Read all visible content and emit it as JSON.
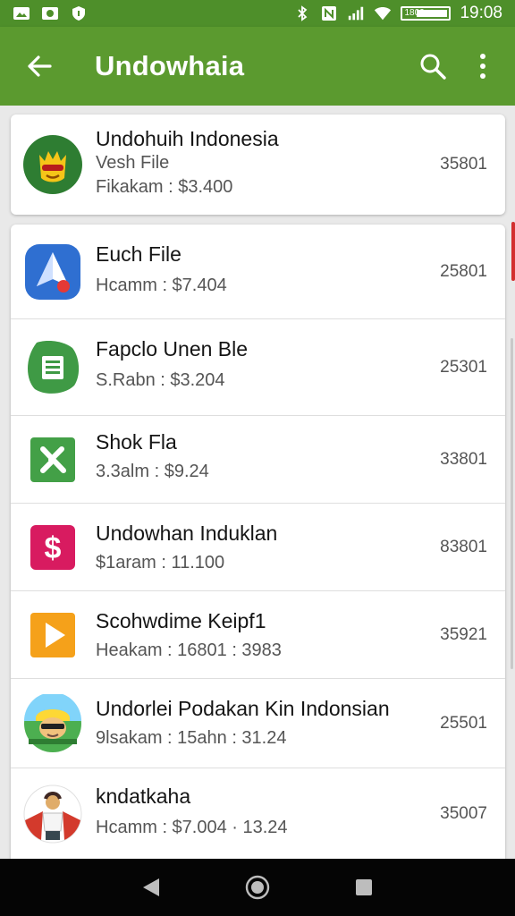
{
  "status_bar": {
    "time": "19:08",
    "battery_label": "1800",
    "signal_text": "1"
  },
  "app_bar": {
    "title": "Undowhaia",
    "back_icon": "arrow-left-icon",
    "search_icon": "search-icon",
    "menu_icon": "more-vert-icon"
  },
  "featured": {
    "title": "Undohuih Indonesia",
    "subtitle": "Vesh File",
    "meta": "Fikakam : $3.400",
    "count": "35801"
  },
  "items": [
    {
      "title": "Euch File",
      "meta": "Hcamm : $7.404",
      "count": "25801",
      "icon": "location-arrow-icon",
      "icon_color": "#2f6fd1"
    },
    {
      "title": "Fapclo Unen Ble",
      "meta": "S.Rabn : $3.204",
      "count": "25301",
      "icon": "sheets-icon",
      "icon_color": "#3f9a45"
    },
    {
      "title": "Shok Fla",
      "meta": "3.3alm : $9.24",
      "count": "33801",
      "icon": "excel-icon",
      "icon_color": "#43a047"
    },
    {
      "title": "Undowhan Induklan",
      "meta": "$1aram : 11.100",
      "count": "83801",
      "icon": "dollar-icon",
      "icon_color": "#d81b60"
    },
    {
      "title": "Scohwdime Keipf1",
      "meta": "Heakam : 16801 : 3983",
      "count": "35921",
      "icon": "play-icon",
      "icon_color": "#f5a11a"
    },
    {
      "title": "Undorlei Podakan Kin Indonsian",
      "meta": "9lsakam : 15ahn : 31.24",
      "count": "25501",
      "icon": "avatar-icon",
      "icon_color": "#3c8d3a"
    },
    {
      "title": "kndatkaha",
      "meta": "Hcamm : $7.004 · 13.24",
      "count": "35007",
      "icon": "person-photo-icon",
      "icon_color": "#d33a2c"
    }
  ],
  "nav": {
    "back": "nav-back-icon",
    "home": "nav-home-icon",
    "recents": "nav-recents-icon"
  },
  "colors": {
    "app_bar": "#5b9a2f",
    "status_bar": "#4e8f2a",
    "accent_red": "#d32f2f"
  }
}
